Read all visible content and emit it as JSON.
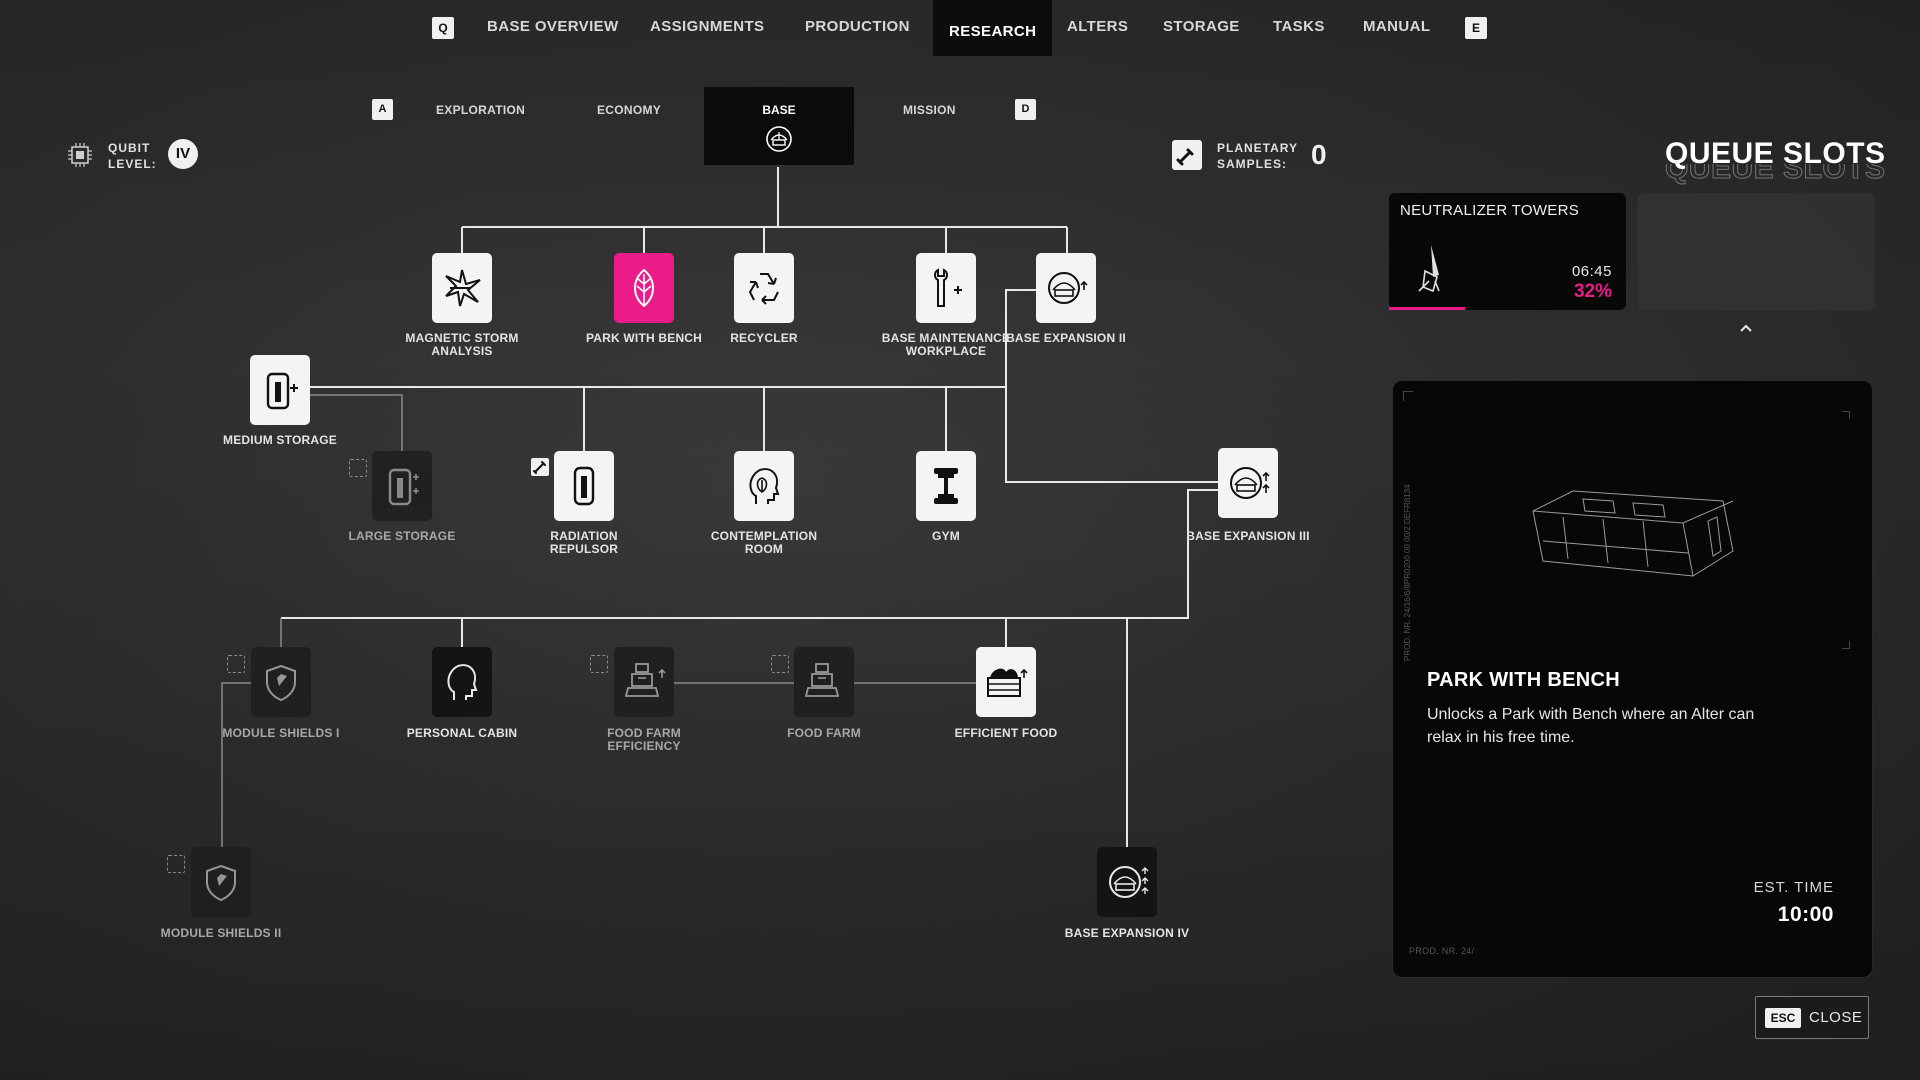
{
  "nav": {
    "left_key": "Q",
    "right_key": "E",
    "items": [
      "BASE OVERVIEW",
      "ASSIGNMENTS",
      "PRODUCTION",
      "RESEARCH",
      "ALTERS",
      "STORAGE",
      "TASKS",
      "MANUAL"
    ],
    "active": "RESEARCH"
  },
  "subtabs": {
    "left_key": "A",
    "right_key": "D",
    "items": [
      "EXPLORATION",
      "ECONOMY",
      "BASE",
      "MISSION"
    ],
    "active": "BASE"
  },
  "stats": {
    "qubit_label_1": "QUBIT",
    "qubit_label_2": "LEVEL:",
    "qubit_value": "IV",
    "samples_label_1": "PLANETARY",
    "samples_label_2": "SAMPLES:",
    "samples_value": "0"
  },
  "tree": {
    "magnetic_storm_analysis": "MAGNETIC STORM ANALYSIS",
    "park_with_bench": "PARK WITH BENCH",
    "recycler": "RECYCLER",
    "base_maintenance_workplace": "BASE MAINTENANCE WORKPLACE",
    "base_expansion_2": "BASE EXPANSION II",
    "medium_storage": "MEDIUM STORAGE",
    "large_storage": "LARGE STORAGE",
    "radiation_repulsor": "RADIATION REPULSOR",
    "contemplation_room": "CONTEMPLATION ROOM",
    "gym": "GYM",
    "base_expansion_3": "BASE EXPANSION III",
    "module_shields_1": "MODULE SHIELDS I",
    "personal_cabin": "PERSONAL CABIN",
    "food_farm_efficiency": "FOOD FARM EFFICIENCY",
    "food_farm": "FOOD FARM",
    "efficient_food": "EFFICIENT FOOD",
    "module_shields_2": "MODULE SHIELDS II",
    "base_expansion_4": "BASE EXPANSION IV"
  },
  "queue": {
    "title": "QUEUE SLOTS",
    "slots": [
      {
        "name": "NEUTRALIZER TOWERS",
        "time": "06:45",
        "percent": "32%",
        "progress": 0.32
      }
    ]
  },
  "detail": {
    "title": "PARK WITH BENCH",
    "description": "Unlocks a Park with Bench where an Alter can relax in his free time.",
    "est_label": "EST. TIME",
    "est_value": "10:00",
    "prod_side": "PROD. NR. 24/16/6/8PR0200 00 00/2 DEFR8134",
    "prod_bottom": "PROD. NR. 24/"
  },
  "close": {
    "key": "ESC",
    "label": "CLOSE"
  },
  "colors": {
    "accent": "#ec1b8a",
    "node_unlocked": "#f4f4f4",
    "node_locked": "#141414"
  }
}
